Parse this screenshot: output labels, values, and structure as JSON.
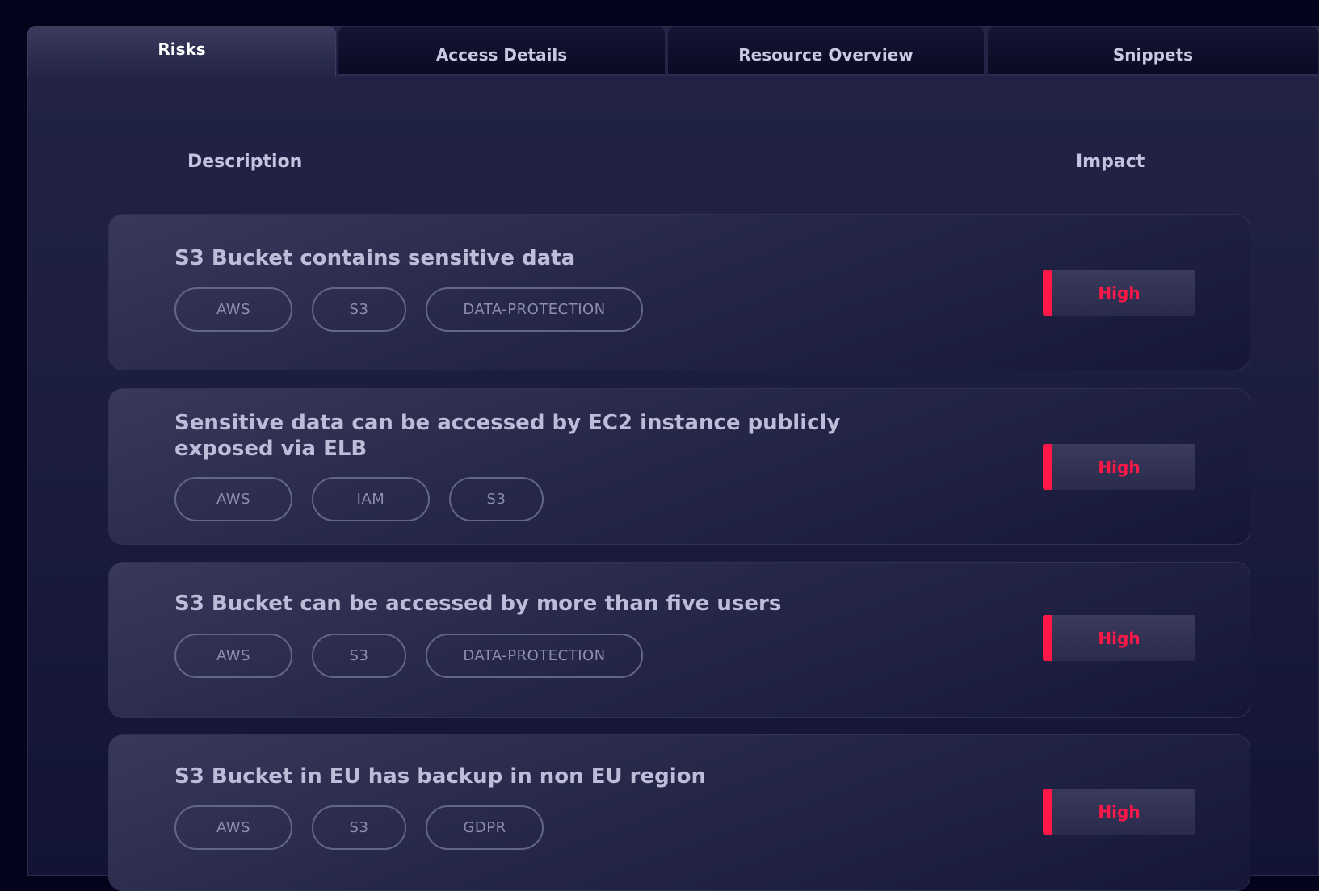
{
  "tabs": [
    {
      "label": "Risks",
      "active": true
    },
    {
      "label": "Access Details",
      "active": false
    },
    {
      "label": "Resource Overview",
      "active": false
    },
    {
      "label": "Snippets",
      "active": false
    }
  ],
  "table": {
    "headers": {
      "description": "Description",
      "impact": "Impact"
    },
    "rows": [
      {
        "title": "S3 Bucket contains sensitive data",
        "tags": [
          "AWS",
          "S3",
          "DATA-PROTECTION"
        ],
        "impact": "High"
      },
      {
        "title": "Sensitive data can be accessed by EC2 instance publicly exposed via ELB",
        "tags": [
          "AWS",
          "IAM",
          "S3"
        ],
        "impact": "High"
      },
      {
        "title": "S3 Bucket can be accessed by more than five users",
        "tags": [
          "AWS",
          "S3",
          "DATA-PROTECTION"
        ],
        "impact": "High"
      },
      {
        "title": "S3 Bucket in EU has backup in non EU region",
        "tags": [
          "AWS",
          "S3",
          "GDPR"
        ],
        "impact": "High"
      }
    ]
  },
  "colors": {
    "impact_high": "#ff1747",
    "background": "#03031c"
  }
}
